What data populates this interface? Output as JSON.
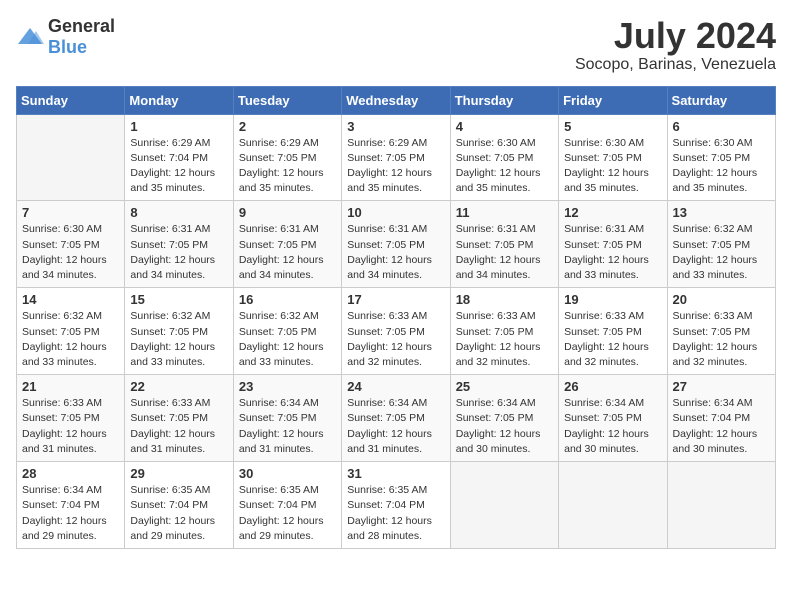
{
  "logo": {
    "general": "General",
    "blue": "Blue"
  },
  "header": {
    "month_year": "July 2024",
    "location": "Socopo, Barinas, Venezuela"
  },
  "weekdays": [
    "Sunday",
    "Monday",
    "Tuesday",
    "Wednesday",
    "Thursday",
    "Friday",
    "Saturday"
  ],
  "weeks": [
    [
      {
        "day": "",
        "empty": true
      },
      {
        "day": "1",
        "sunrise": "Sunrise: 6:29 AM",
        "sunset": "Sunset: 7:04 PM",
        "daylight": "Daylight: 12 hours and 35 minutes."
      },
      {
        "day": "2",
        "sunrise": "Sunrise: 6:29 AM",
        "sunset": "Sunset: 7:05 PM",
        "daylight": "Daylight: 12 hours and 35 minutes."
      },
      {
        "day": "3",
        "sunrise": "Sunrise: 6:29 AM",
        "sunset": "Sunset: 7:05 PM",
        "daylight": "Daylight: 12 hours and 35 minutes."
      },
      {
        "day": "4",
        "sunrise": "Sunrise: 6:30 AM",
        "sunset": "Sunset: 7:05 PM",
        "daylight": "Daylight: 12 hours and 35 minutes."
      },
      {
        "day": "5",
        "sunrise": "Sunrise: 6:30 AM",
        "sunset": "Sunset: 7:05 PM",
        "daylight": "Daylight: 12 hours and 35 minutes."
      },
      {
        "day": "6",
        "sunrise": "Sunrise: 6:30 AM",
        "sunset": "Sunset: 7:05 PM",
        "daylight": "Daylight: 12 hours and 35 minutes."
      }
    ],
    [
      {
        "day": "7",
        "sunrise": "Sunrise: 6:30 AM",
        "sunset": "Sunset: 7:05 PM",
        "daylight": "Daylight: 12 hours and 34 minutes."
      },
      {
        "day": "8",
        "sunrise": "Sunrise: 6:31 AM",
        "sunset": "Sunset: 7:05 PM",
        "daylight": "Daylight: 12 hours and 34 minutes."
      },
      {
        "day": "9",
        "sunrise": "Sunrise: 6:31 AM",
        "sunset": "Sunset: 7:05 PM",
        "daylight": "Daylight: 12 hours and 34 minutes."
      },
      {
        "day": "10",
        "sunrise": "Sunrise: 6:31 AM",
        "sunset": "Sunset: 7:05 PM",
        "daylight": "Daylight: 12 hours and 34 minutes."
      },
      {
        "day": "11",
        "sunrise": "Sunrise: 6:31 AM",
        "sunset": "Sunset: 7:05 PM",
        "daylight": "Daylight: 12 hours and 34 minutes."
      },
      {
        "day": "12",
        "sunrise": "Sunrise: 6:31 AM",
        "sunset": "Sunset: 7:05 PM",
        "daylight": "Daylight: 12 hours and 33 minutes."
      },
      {
        "day": "13",
        "sunrise": "Sunrise: 6:32 AM",
        "sunset": "Sunset: 7:05 PM",
        "daylight": "Daylight: 12 hours and 33 minutes."
      }
    ],
    [
      {
        "day": "14",
        "sunrise": "Sunrise: 6:32 AM",
        "sunset": "Sunset: 7:05 PM",
        "daylight": "Daylight: 12 hours and 33 minutes."
      },
      {
        "day": "15",
        "sunrise": "Sunrise: 6:32 AM",
        "sunset": "Sunset: 7:05 PM",
        "daylight": "Daylight: 12 hours and 33 minutes."
      },
      {
        "day": "16",
        "sunrise": "Sunrise: 6:32 AM",
        "sunset": "Sunset: 7:05 PM",
        "daylight": "Daylight: 12 hours and 33 minutes."
      },
      {
        "day": "17",
        "sunrise": "Sunrise: 6:33 AM",
        "sunset": "Sunset: 7:05 PM",
        "daylight": "Daylight: 12 hours and 32 minutes."
      },
      {
        "day": "18",
        "sunrise": "Sunrise: 6:33 AM",
        "sunset": "Sunset: 7:05 PM",
        "daylight": "Daylight: 12 hours and 32 minutes."
      },
      {
        "day": "19",
        "sunrise": "Sunrise: 6:33 AM",
        "sunset": "Sunset: 7:05 PM",
        "daylight": "Daylight: 12 hours and 32 minutes."
      },
      {
        "day": "20",
        "sunrise": "Sunrise: 6:33 AM",
        "sunset": "Sunset: 7:05 PM",
        "daylight": "Daylight: 12 hours and 32 minutes."
      }
    ],
    [
      {
        "day": "21",
        "sunrise": "Sunrise: 6:33 AM",
        "sunset": "Sunset: 7:05 PM",
        "daylight": "Daylight: 12 hours and 31 minutes."
      },
      {
        "day": "22",
        "sunrise": "Sunrise: 6:33 AM",
        "sunset": "Sunset: 7:05 PM",
        "daylight": "Daylight: 12 hours and 31 minutes."
      },
      {
        "day": "23",
        "sunrise": "Sunrise: 6:34 AM",
        "sunset": "Sunset: 7:05 PM",
        "daylight": "Daylight: 12 hours and 31 minutes."
      },
      {
        "day": "24",
        "sunrise": "Sunrise: 6:34 AM",
        "sunset": "Sunset: 7:05 PM",
        "daylight": "Daylight: 12 hours and 31 minutes."
      },
      {
        "day": "25",
        "sunrise": "Sunrise: 6:34 AM",
        "sunset": "Sunset: 7:05 PM",
        "daylight": "Daylight: 12 hours and 30 minutes."
      },
      {
        "day": "26",
        "sunrise": "Sunrise: 6:34 AM",
        "sunset": "Sunset: 7:05 PM",
        "daylight": "Daylight: 12 hours and 30 minutes."
      },
      {
        "day": "27",
        "sunrise": "Sunrise: 6:34 AM",
        "sunset": "Sunset: 7:04 PM",
        "daylight": "Daylight: 12 hours and 30 minutes."
      }
    ],
    [
      {
        "day": "28",
        "sunrise": "Sunrise: 6:34 AM",
        "sunset": "Sunset: 7:04 PM",
        "daylight": "Daylight: 12 hours and 29 minutes."
      },
      {
        "day": "29",
        "sunrise": "Sunrise: 6:35 AM",
        "sunset": "Sunset: 7:04 PM",
        "daylight": "Daylight: 12 hours and 29 minutes."
      },
      {
        "day": "30",
        "sunrise": "Sunrise: 6:35 AM",
        "sunset": "Sunset: 7:04 PM",
        "daylight": "Daylight: 12 hours and 29 minutes."
      },
      {
        "day": "31",
        "sunrise": "Sunrise: 6:35 AM",
        "sunset": "Sunset: 7:04 PM",
        "daylight": "Daylight: 12 hours and 28 minutes."
      },
      {
        "day": "",
        "empty": true
      },
      {
        "day": "",
        "empty": true
      },
      {
        "day": "",
        "empty": true
      }
    ]
  ]
}
